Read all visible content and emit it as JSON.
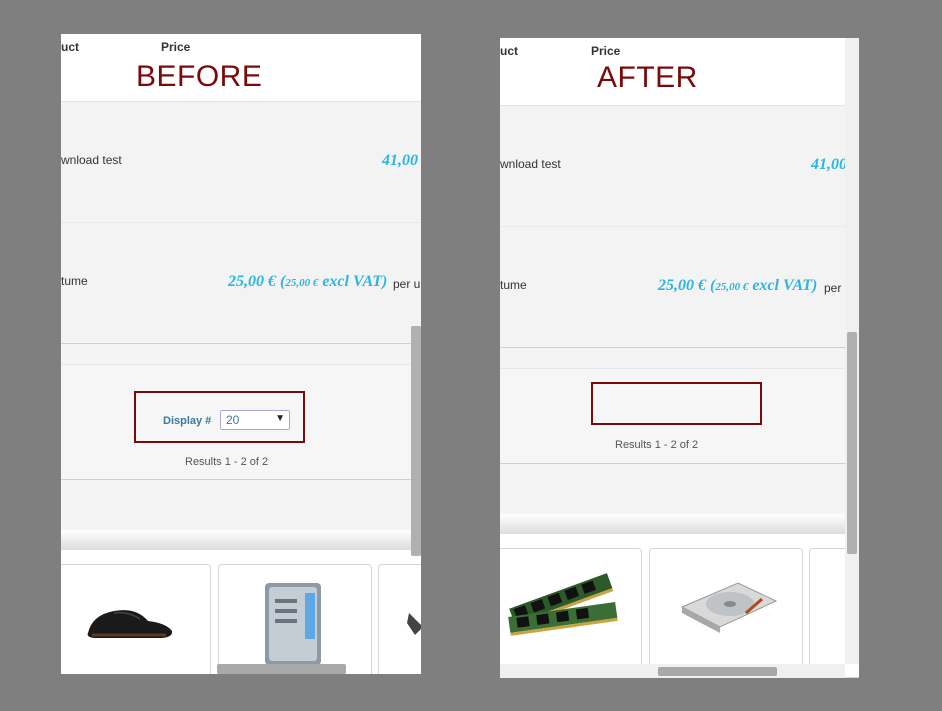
{
  "before": {
    "label": "BEFORE",
    "columns": {
      "product": "uct",
      "price": "Price"
    },
    "rows": [
      {
        "name": "wnload test",
        "price": "41,00"
      },
      {
        "name": "tume",
        "price_main": "25,00 €",
        "price_open": " (",
        "price_small": "25,00 €",
        "price_excl": " excl VAT)",
        "per": " per u"
      }
    ],
    "display": {
      "label": "Display #",
      "value": "20"
    },
    "results": "Results 1 - 2 of 2"
  },
  "after": {
    "label": "AFTER",
    "columns": {
      "product": "uct",
      "price": "Price"
    },
    "rows": [
      {
        "name": "wnload test",
        "price": "41,00"
      },
      {
        "name": "tume",
        "price_main": "25,00 €",
        "price_open": " (",
        "price_small": "25,00 €",
        "price_excl": " excl VAT)",
        "per": " per"
      }
    ],
    "results": "Results 1 - 2 of 2"
  },
  "icons": {
    "shoe": "shoe-product-image",
    "server": "server-product-image",
    "ram": "ram-product-image",
    "hdd": "hard-drive-product-image"
  },
  "colors": {
    "label": "#7a0a0a",
    "price": "#2bb5e0",
    "background": "#7f7f7f"
  }
}
